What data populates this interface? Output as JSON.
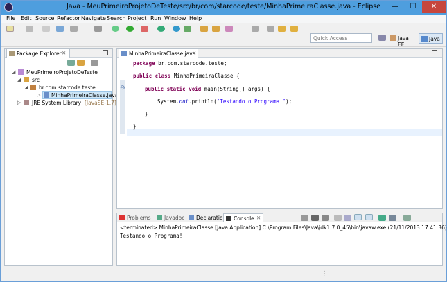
{
  "window": {
    "title": "Java - MeuPrimeiroProjetoDeTeste/src/br/com/starcode/teste/MinhaPrimeiraClasse.java - Eclipse",
    "minimize": "—",
    "maximize": "☐",
    "close": "✕"
  },
  "menu": [
    "File",
    "Edit",
    "Source",
    "Refactor",
    "Navigate",
    "Search",
    "Project",
    "Run",
    "Window",
    "Help"
  ],
  "toolbar": {
    "quick_access_placeholder": "Quick Access",
    "perspectives": [
      {
        "label": "Java EE",
        "icon": "java-ee-perspective-icon"
      },
      {
        "label": "Java",
        "icon": "java-perspective-icon",
        "active": true
      }
    ]
  },
  "package_explorer": {
    "tab_label": "Package Explorer",
    "close_glyph": "✕",
    "tree": [
      {
        "label": "MeuPrimeiroProjetoDeTeste",
        "toggle": "◢"
      },
      {
        "label": "src",
        "toggle": "◢"
      },
      {
        "label": "br.com.starcode.teste",
        "toggle": "◢"
      },
      {
        "label": "MinhaPrimeiraClasse.java",
        "toggle": "▷",
        "selected": true
      },
      {
        "label": "JRE System Library",
        "suffix": "[JavaSE-1.7]",
        "toggle": "▷"
      }
    ]
  },
  "editor": {
    "tab_label": "MinhaPrimeiraClasse.java",
    "close_glyph": "✕",
    "fold_glyph": "⊖",
    "lines": {
      "l1": {
        "kw": "package",
        "rest": " br.com.starcode.teste;"
      },
      "l2": {
        "kw": "public class",
        "rest": " MinhaPrimeiraClasse {"
      },
      "l3": {
        "kw": "public static void",
        "rest": " main(String[] args) {"
      },
      "l4": {
        "pre": "System.",
        "field": "out",
        "post": ".println(",
        "str": "\"Testando o Programa!\"",
        "end": ");"
      },
      "l5": "}",
      "l6": "}"
    }
  },
  "bottom_tabs": {
    "problems": "Problems",
    "javadoc": "Javadoc",
    "declaration": "Declaration",
    "console": "Console",
    "close_glyph": "✕"
  },
  "console": {
    "header": "<terminated> MinhaPrimeiraClasse [Java Application] C:\\Program Files\\Java\\jdk1.7.0_45\\bin\\javaw.exe (21/11/2013 17:41:36)",
    "output": "Testando o Programa!"
  },
  "status_bar": {
    "handle": "⋮"
  },
  "colors": {
    "titlebar": "#4e9ede",
    "keyword": "#7f0055",
    "string": "#2a00ff",
    "selection": "#cde6f7"
  }
}
